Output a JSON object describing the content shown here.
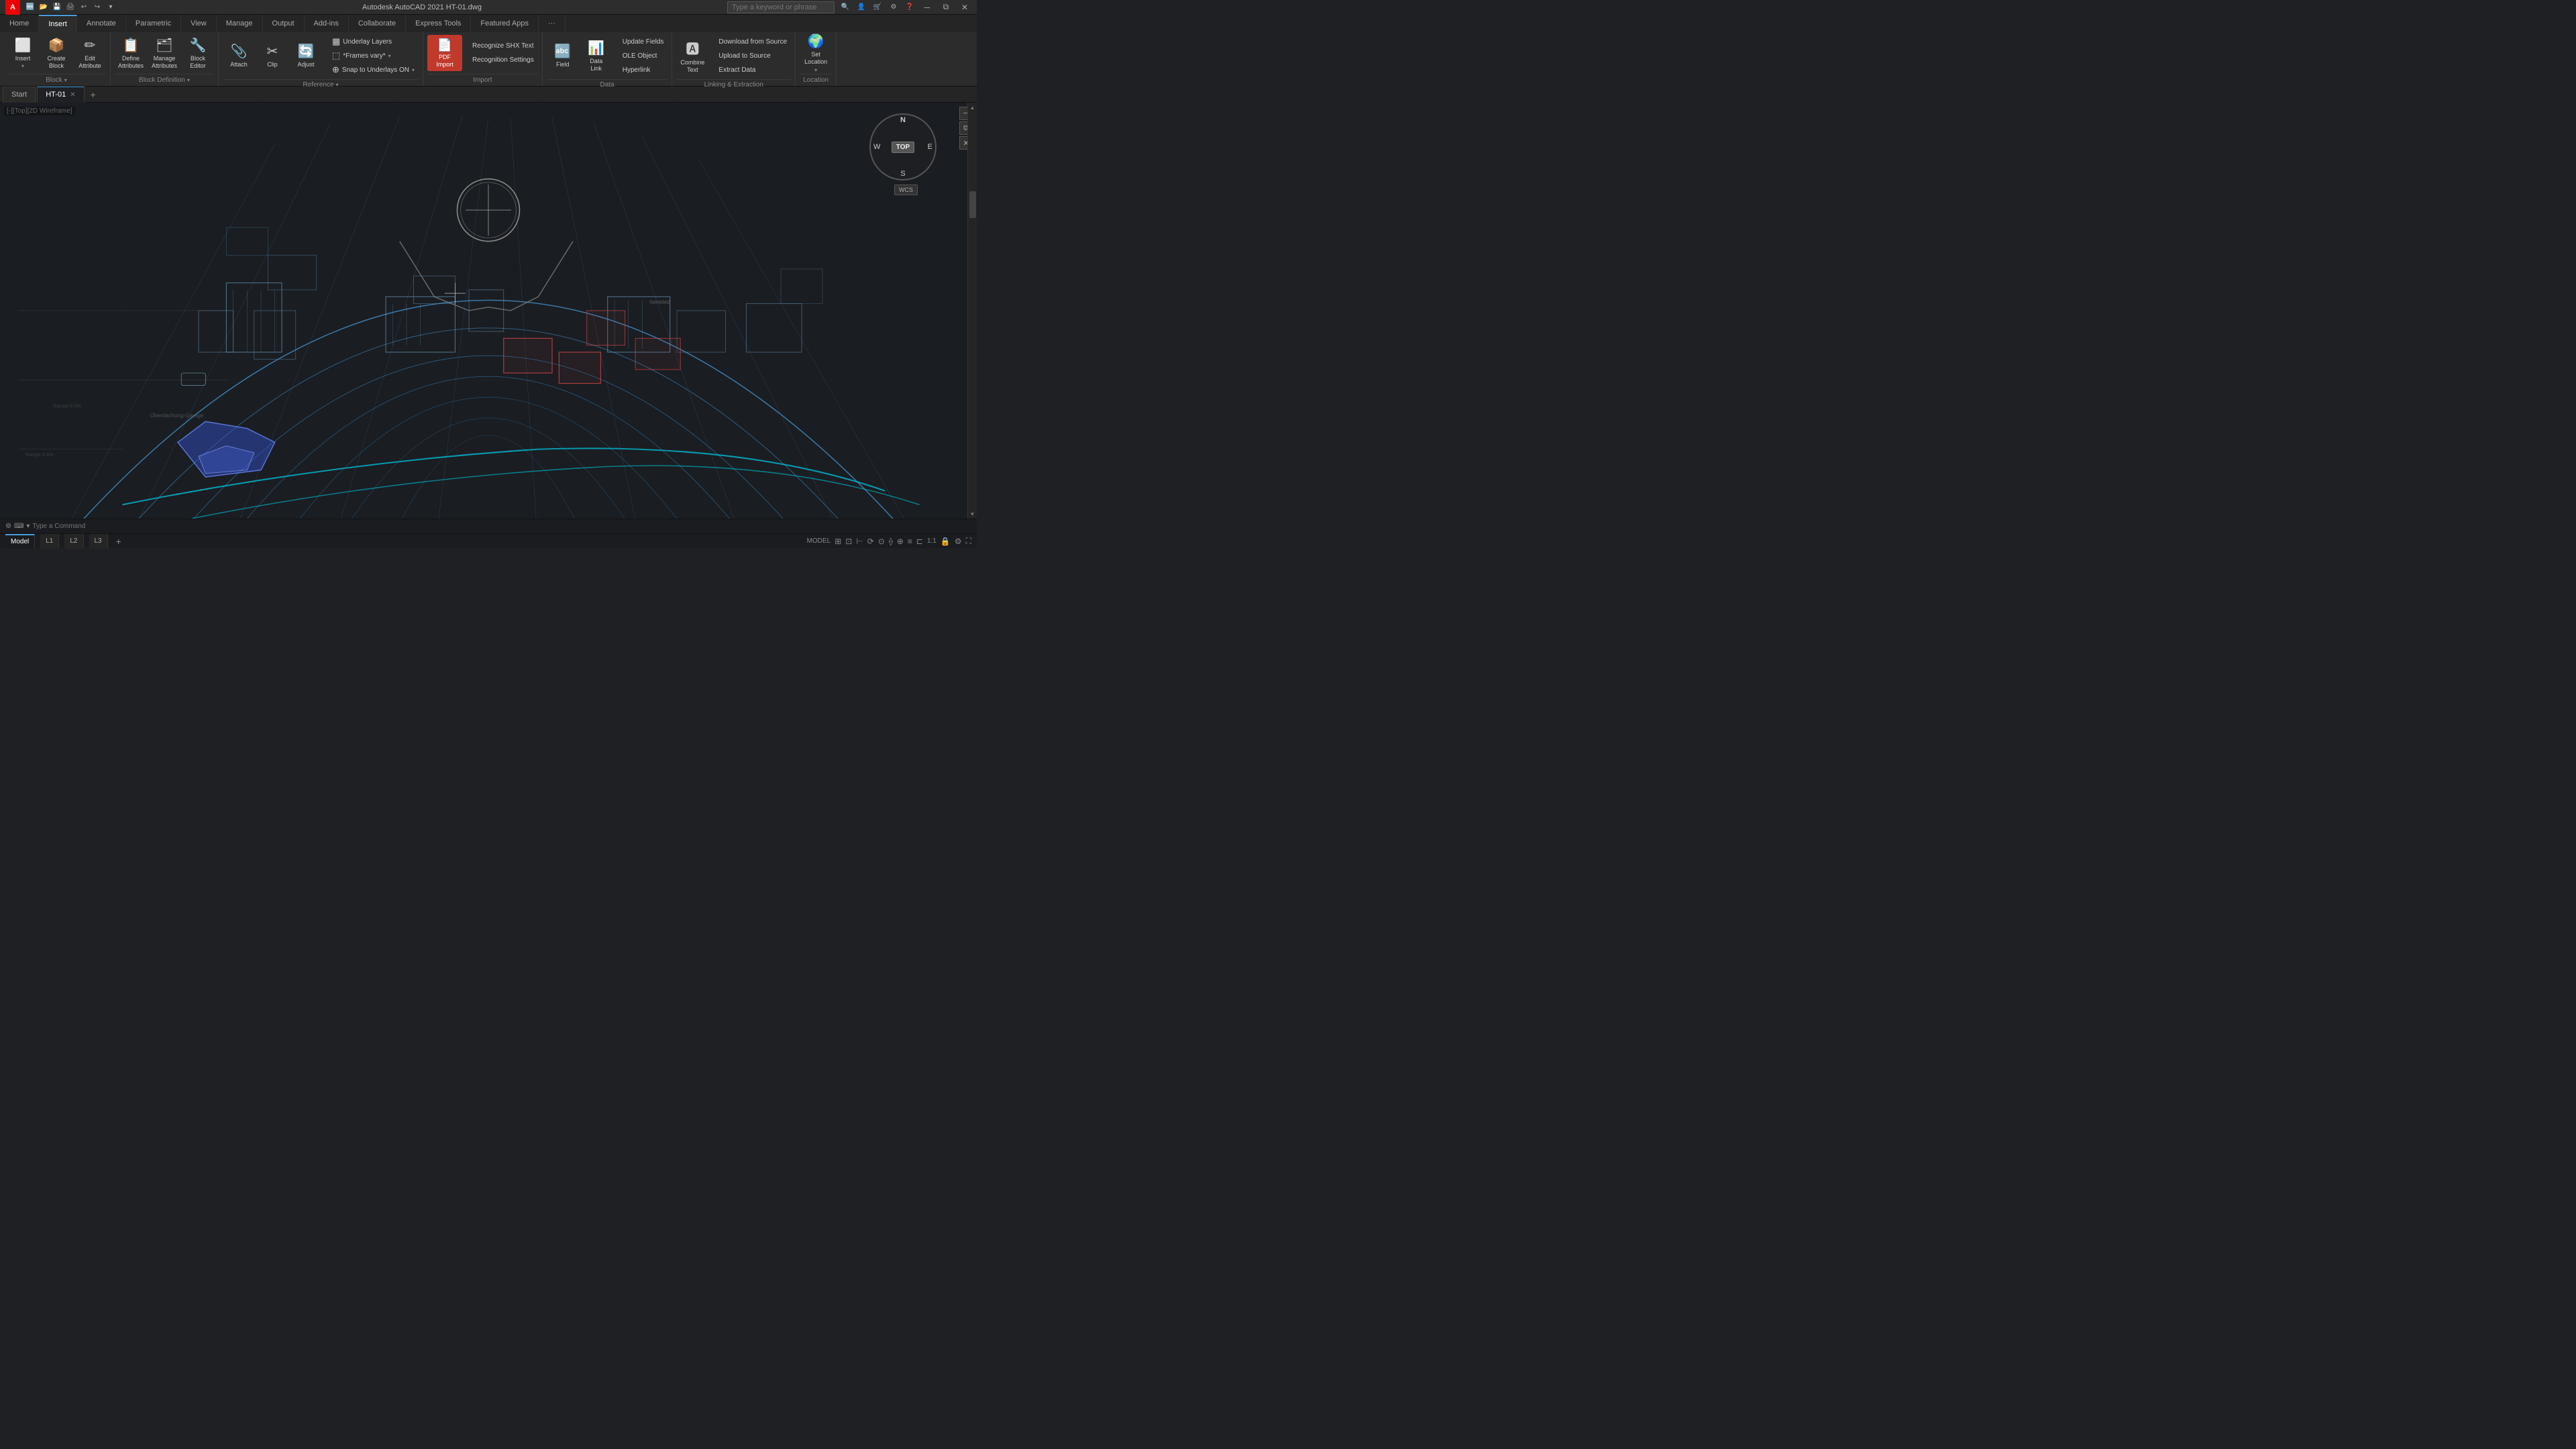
{
  "titlebar": {
    "logo": "A",
    "app_title": "Autodesk AutoCAD 2021",
    "file_name": "HT-01.dwg",
    "full_title": "Autodesk AutoCAD 2021  HT-01.dwg",
    "search_placeholder": "Type a keyword or phrase",
    "quick_access": [
      "new",
      "open",
      "save",
      "plot",
      "undo",
      "redo",
      "customize"
    ],
    "win_btns": [
      "minimize",
      "restore",
      "close"
    ]
  },
  "ribbon": {
    "tabs": [
      "Home",
      "Insert",
      "Annotate",
      "Parametric",
      "View",
      "Manage",
      "Output",
      "Add-ins",
      "Collaborate",
      "Express Tools",
      "Featured Apps",
      "..."
    ],
    "active_tab": "Insert",
    "groups": [
      {
        "label": "Block",
        "items": [
          {
            "type": "large",
            "icon": "⬜",
            "label": "Insert",
            "sublabel": "",
            "dropdown": true
          },
          {
            "type": "large",
            "icon": "📦",
            "label": "Create\nBlock",
            "dropdown": true
          },
          {
            "type": "large",
            "icon": "✏️",
            "label": "Edit\nAttribute",
            "dropdown": false
          }
        ]
      },
      {
        "label": "Block Definition",
        "items": [
          {
            "type": "large",
            "icon": "📋",
            "label": "Define\nAttributes",
            "dropdown": false
          },
          {
            "type": "large",
            "icon": "🗂️",
            "label": "Manage\nAttributes",
            "dropdown": false
          },
          {
            "type": "large",
            "icon": "🔧",
            "label": "Block\nEditor",
            "dropdown": false
          }
        ]
      },
      {
        "label": "Reference",
        "items": [
          {
            "type": "large",
            "icon": "📎",
            "label": "Attach",
            "dropdown": false
          },
          {
            "type": "large",
            "icon": "✂️",
            "label": "Clip",
            "dropdown": false
          },
          {
            "type": "large",
            "icon": "🔄",
            "label": "Adjust",
            "dropdown": false
          }
        ],
        "extra_rows": [
          "Underlay Layers",
          "*Frames vary*",
          "Snap to Underlays ON"
        ]
      },
      {
        "label": "Import",
        "items": [
          {
            "type": "large",
            "icon": "📄",
            "label": "PDF\nImport",
            "dropdown": false
          }
        ],
        "small_items": [
          "Recognize SHX Text",
          "Recognition Settings"
        ]
      },
      {
        "label": "Data",
        "items": [
          {
            "type": "large",
            "icon": "🔤",
            "label": "Field",
            "dropdown": false
          },
          {
            "type": "large",
            "icon": "📊",
            "label": "Data\nLink",
            "dropdown": false
          }
        ],
        "small_items": [
          "Update Fields",
          "OLE Object",
          "Hyperlink"
        ]
      },
      {
        "label": "Linking & Extraction",
        "items": [
          {
            "type": "large",
            "icon": "🌐",
            "label": "Combine\nText",
            "dropdown": false
          }
        ],
        "small_items": [
          "Download from Source",
          "Upload to Source",
          "Extract  Data"
        ]
      },
      {
        "label": "Location",
        "items": [
          {
            "type": "large",
            "icon": "🌍",
            "label": "Set\nLocation",
            "dropdown": false
          }
        ]
      }
    ]
  },
  "doc_tabs": [
    {
      "label": "Start",
      "active": false,
      "closeable": false
    },
    {
      "label": "HT-01",
      "active": true,
      "closeable": true
    }
  ],
  "viewport": {
    "label": "[-][Top][2D Wireframe]",
    "compass": {
      "n": "N",
      "s": "S",
      "e": "E",
      "w": "W",
      "center_btn": "TOP"
    },
    "wcs": "WCS"
  },
  "statusbar": {
    "model_tabs": [
      "Model",
      "L1",
      "L2",
      "L3"
    ],
    "active_tab": "Model",
    "mode": "MODEL",
    "icons": [
      "grid",
      "snap",
      "ortho",
      "polar",
      "osnap",
      "otrack",
      "ducs",
      "dyn",
      "lw",
      "tp",
      "qp",
      "sc",
      "am",
      "zoom",
      "settings"
    ],
    "zoom_level": "1:1"
  },
  "cmdline": {
    "prompt": "Type a Command",
    "icons": [
      "settings",
      "keyboard",
      "arrow"
    ]
  }
}
